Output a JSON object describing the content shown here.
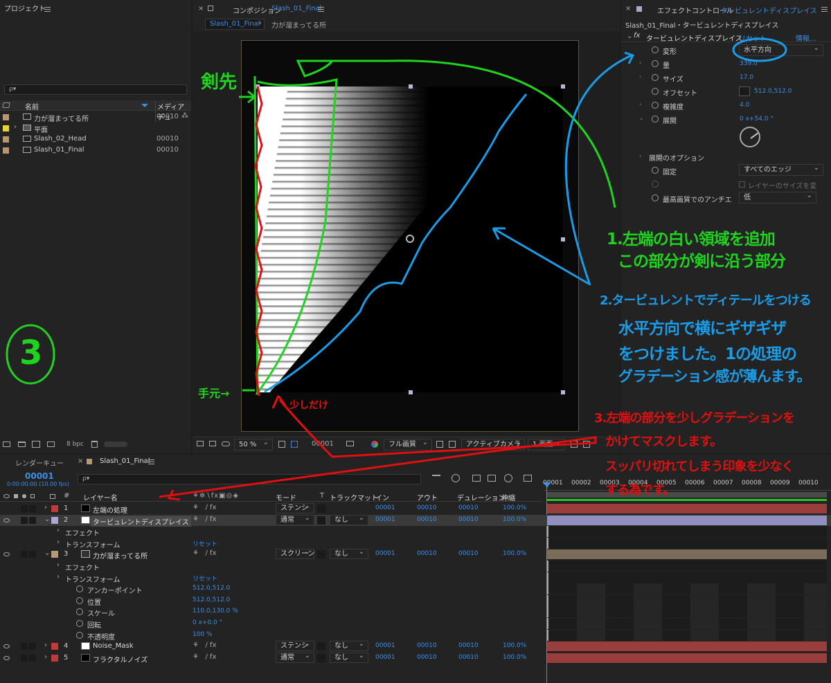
{
  "project": {
    "title": "プロジェクト",
    "search_placeholder": "ρ▾",
    "col_name": "名前",
    "col_media": "メディアデュ",
    "items": [
      {
        "name": "力が溜まってる所",
        "dur": "00010",
        "color": "#b49a74"
      },
      {
        "name": "平面",
        "dur": "",
        "color": "#e8d23a"
      },
      {
        "name": "Slash_02_Head",
        "dur": "00010",
        "color": "#b49a74"
      },
      {
        "name": "Slash_01_Final",
        "dur": "00010",
        "color": "#b49a74"
      }
    ],
    "bpc": "8 bpc"
  },
  "composition": {
    "close": "×",
    "tab_prefix": "コンポジション",
    "tab_name": "Slash_01_Final",
    "crumb_active": "Slash_01_Final",
    "crumb_next": "力が溜まってる所",
    "zoom": "50 %",
    "timecode": "00001",
    "quality": "フル画質",
    "camera": "アクティブカメラ",
    "views": "1 画面"
  },
  "effects": {
    "tab_prefix": "エフェクトコントロール",
    "tab_name": "タービュレントディスプレイス",
    "subtitle": "Slash_01_Final・タービュレントディスプレイス",
    "effect_name": "タービュレントディスプレイス",
    "reset": "リセット",
    "info": "情報...",
    "props": [
      {
        "label": "変形",
        "value": "水平方向",
        "kind": "select"
      },
      {
        "label": "量",
        "value": "339.0",
        "kind": "num"
      },
      {
        "label": "サイズ",
        "value": "17.0",
        "kind": "num"
      },
      {
        "label": "オフセット",
        "value": "512.0,512.0",
        "kind": "point"
      },
      {
        "label": "複雑度",
        "value": "4.0",
        "kind": "num"
      },
      {
        "label": "展開",
        "value": "0 x+54.0 °",
        "kind": "angle"
      }
    ],
    "options_label": "展開のオプション",
    "pin_label": "固定",
    "pin_value": "すべてのエッジ",
    "resize_label": "レイヤーのサイズを変",
    "antialias_label": "最高画質でのアンチエ",
    "antialias_value": "低"
  },
  "timeline": {
    "render_queue": "レンダーキュー",
    "tab_name": "Slash_01_Final",
    "timecode": "00001",
    "timecode_sub": "0:00:00:00 (10.00 fps)",
    "search_placeholder": "ρ▾",
    "headers": {
      "num": "#",
      "layer": "レイヤー名",
      "mode": "モード",
      "t": "T",
      "matte": "トラックマット",
      "in": "イン",
      "out": "アウト",
      "dur": "デュレーション",
      "stretch": "伸縮"
    },
    "ruler": [
      "00001",
      "00002",
      "00003",
      "00004",
      "00005",
      "00006",
      "00007",
      "00008",
      "00009",
      "00010"
    ],
    "rows": [
      {
        "type": "layer",
        "num": "1",
        "name": "左端の処理",
        "chip": "#c03a3a",
        "swatch": "#000000",
        "mode": "ステンシ",
        "matte": "",
        "in": "00001",
        "out": "00010",
        "dur": "00010",
        "stretch": "100.0%",
        "bar": "#9a3d3d",
        "expanded": false
      },
      {
        "type": "layer",
        "num": "2",
        "name": "タービュレントディスプレイス",
        "chip": "#a9a9d0",
        "swatch": "#ffffff",
        "mode": "通常",
        "matte": "なし",
        "in": "00001",
        "out": "00010",
        "dur": "00010",
        "stretch": "100.0%",
        "bar": "#8f8fc0",
        "expanded": true,
        "selected": true
      },
      {
        "type": "group",
        "label": "エフェクト"
      },
      {
        "type": "group",
        "label": "トランスフォーム",
        "value": "リセット"
      },
      {
        "type": "layer",
        "num": "3",
        "name": "力が溜まってる所",
        "chip": "#b49a74",
        "swatch": "comp",
        "mode": "スクリーン",
        "matte": "なし",
        "in": "00001",
        "out": "00010",
        "dur": "00010",
        "stretch": "100.0%",
        "bar": "#7a6c58",
        "expanded": true
      },
      {
        "type": "group",
        "label": "エフェクト"
      },
      {
        "type": "group",
        "label": "トランスフォーム",
        "value": "リセット"
      },
      {
        "type": "prop",
        "label": "アンカーポイント",
        "value": "512.0,512.0"
      },
      {
        "type": "prop",
        "label": "位置",
        "value": "512.0,512.0"
      },
      {
        "type": "prop",
        "label": "スケール",
        "value": "110.0,130.0 %"
      },
      {
        "type": "prop",
        "label": "回転",
        "value": "0 x+0.0 °"
      },
      {
        "type": "prop",
        "label": "不透明度",
        "value": "100 %"
      },
      {
        "type": "layer",
        "num": "4",
        "name": "Noise_Mask",
        "chip": "#c03a3a",
        "swatch": "#ffffff",
        "mode": "ステンシ",
        "matte": "なし",
        "in": "00001",
        "out": "00010",
        "dur": "00010",
        "stretch": "100.0%",
        "bar": "#9a3d3d",
        "expanded": false
      },
      {
        "type": "layer",
        "num": "5",
        "name": "フラクタルノイズ",
        "chip": "#c03a3a",
        "swatch": "#000000",
        "mode": "通常",
        "matte": "なし",
        "in": "00001",
        "out": "00010",
        "dur": "00010",
        "stretch": "100.0%",
        "bar": "#9a3d3d",
        "expanded": false
      }
    ]
  },
  "annotations": {
    "tip": "剣先",
    "hand": "手元→",
    "slight": "少しだけ",
    "circle3": "3",
    "note1_l1": "1.左端の白い領域を追加",
    "note1_l2": "この部分が剣に沿う部分",
    "note2_l1": "2.タービュレントでディテールをつける",
    "note2_l2": "水平方向で横にギザギザ",
    "note2_l3": "をつけました。1の処理の",
    "note2_l4": "グラデーション感が薄んます。",
    "note3_l1": "3.左端の部分を少しグラデーションを",
    "note3_l2": "かけてマスクします。",
    "note3_l3": "スッパリ切れてしまう印象を少なく",
    "note3_l4": "する為です。",
    "green": "#1fd31f",
    "blue": "#1a9ce8",
    "red": "#e01010"
  }
}
